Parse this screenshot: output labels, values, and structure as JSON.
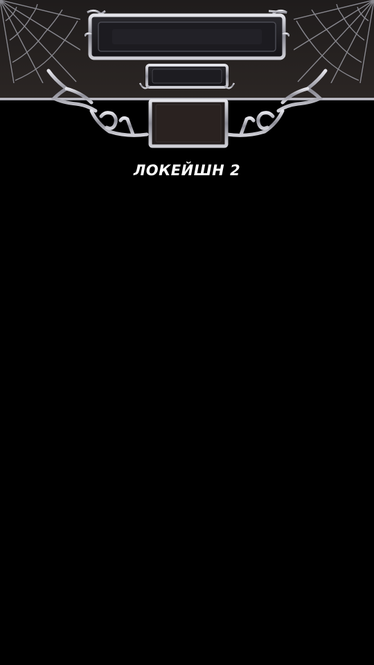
{
  "location": {
    "title": "ЛОКЕЙШН 2"
  },
  "icons": {
    "cobweb_left": "cobweb-icon",
    "cobweb_right": "cobweb-icon",
    "ornament_left": "tribal-ornament-icon",
    "ornament_right": "tribal-ornament-icon"
  },
  "colors": {
    "background": "#000000",
    "header_band": "#2b2624",
    "metal_frame": "#b8b8c2",
    "plate_fill": "#1a191d",
    "label_text": "#ffffff"
  }
}
